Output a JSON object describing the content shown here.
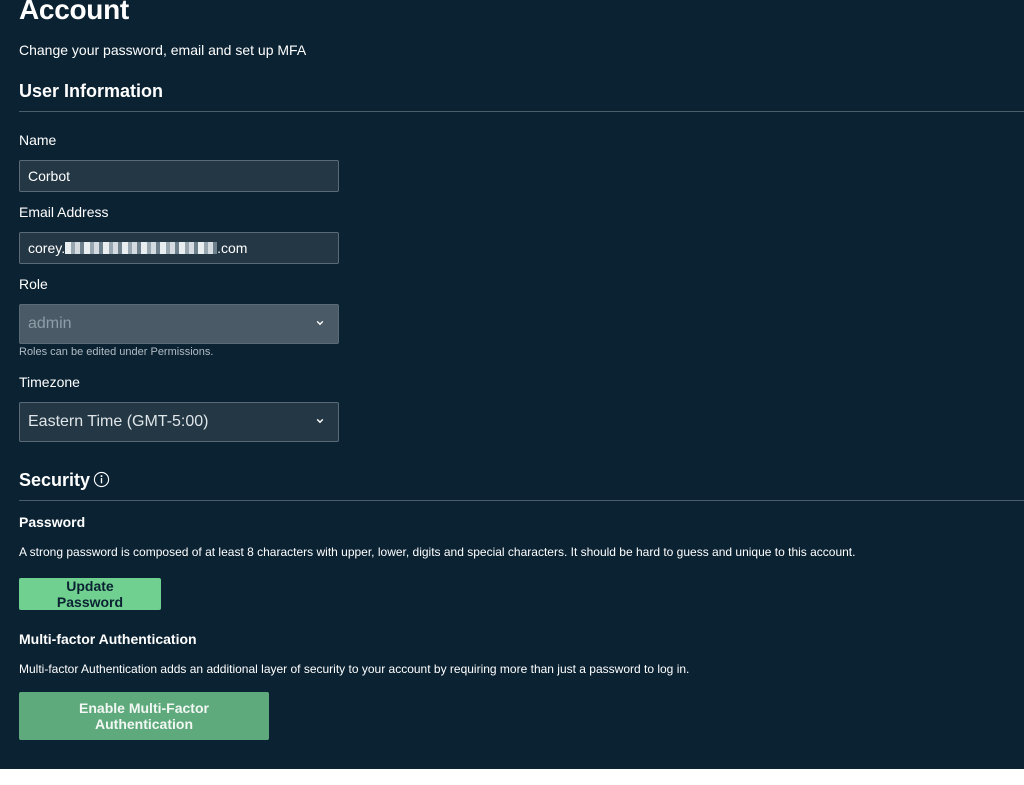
{
  "header": {
    "title": "Account",
    "subtitle": "Change your password, email and set up MFA"
  },
  "user_information": {
    "section_title": "User Information",
    "name": {
      "label": "Name",
      "value": "Corbot"
    },
    "email": {
      "label": "Email Address",
      "value_prefix": "corey.",
      "value_suffix": ".com"
    },
    "role": {
      "label": "Role",
      "value": "admin",
      "helper": "Roles can be edited under Permissions."
    },
    "timezone": {
      "label": "Timezone",
      "value": "Eastern Time (GMT-5:00)"
    }
  },
  "security": {
    "section_title": "Security",
    "password": {
      "heading": "Password",
      "description": "A strong password is composed of at least 8 characters with upper, lower, digits and special characters. It should be hard to guess and unique to this account.",
      "button_label": "Update Password"
    },
    "mfa": {
      "heading": "Multi-factor Authentication",
      "description": "Multi-factor Authentication adds an additional layer of security to your account by requiring more than just a password to log in.",
      "button_label": "Enable Multi-Factor Authentication"
    }
  },
  "icons": {
    "info": "info-icon",
    "chevron": "chevron-down-icon"
  },
  "colors": {
    "background": "#0b2232",
    "accent_button": "#6fd08f",
    "mfa_button": "#5eaa7c",
    "input_background": "#233744"
  }
}
